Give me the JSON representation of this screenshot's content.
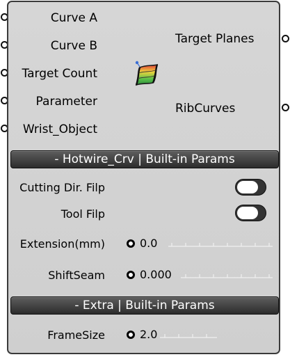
{
  "inputs": [
    {
      "label": "Curve A"
    },
    {
      "label": "Curve B"
    },
    {
      "label": "Target Count"
    },
    {
      "label": "Parameter"
    },
    {
      "label": "Wrist_Object"
    }
  ],
  "outputs": [
    {
      "label": "Target Planes"
    },
    {
      "label": "RibCurves"
    }
  ],
  "component_icon": "hotwire-surface-icon",
  "sections": {
    "builtin": {
      "title": "- Hotwire_Crv | Built-in Params",
      "toggles": [
        {
          "label": "Cutting Dir. Filp",
          "state": "off"
        },
        {
          "label": "Tool Filp",
          "state": "off"
        }
      ],
      "sliders": [
        {
          "label": "Extension(mm)",
          "value": "0.0"
        },
        {
          "label": "ShiftSeam",
          "value": "0.000"
        }
      ]
    },
    "extra": {
      "title": "- Extra | Built-in Params",
      "sliders": [
        {
          "label": "FrameSize",
          "value": "2.0"
        }
      ]
    }
  },
  "colors": {
    "panel_background": "#d3d3d3",
    "panel_border": "#3a3a3a",
    "section_bar": "#3c3c3c",
    "section_text": "#ffffff",
    "toggle_track": "#333333",
    "toggle_knob": "#ffffff"
  }
}
